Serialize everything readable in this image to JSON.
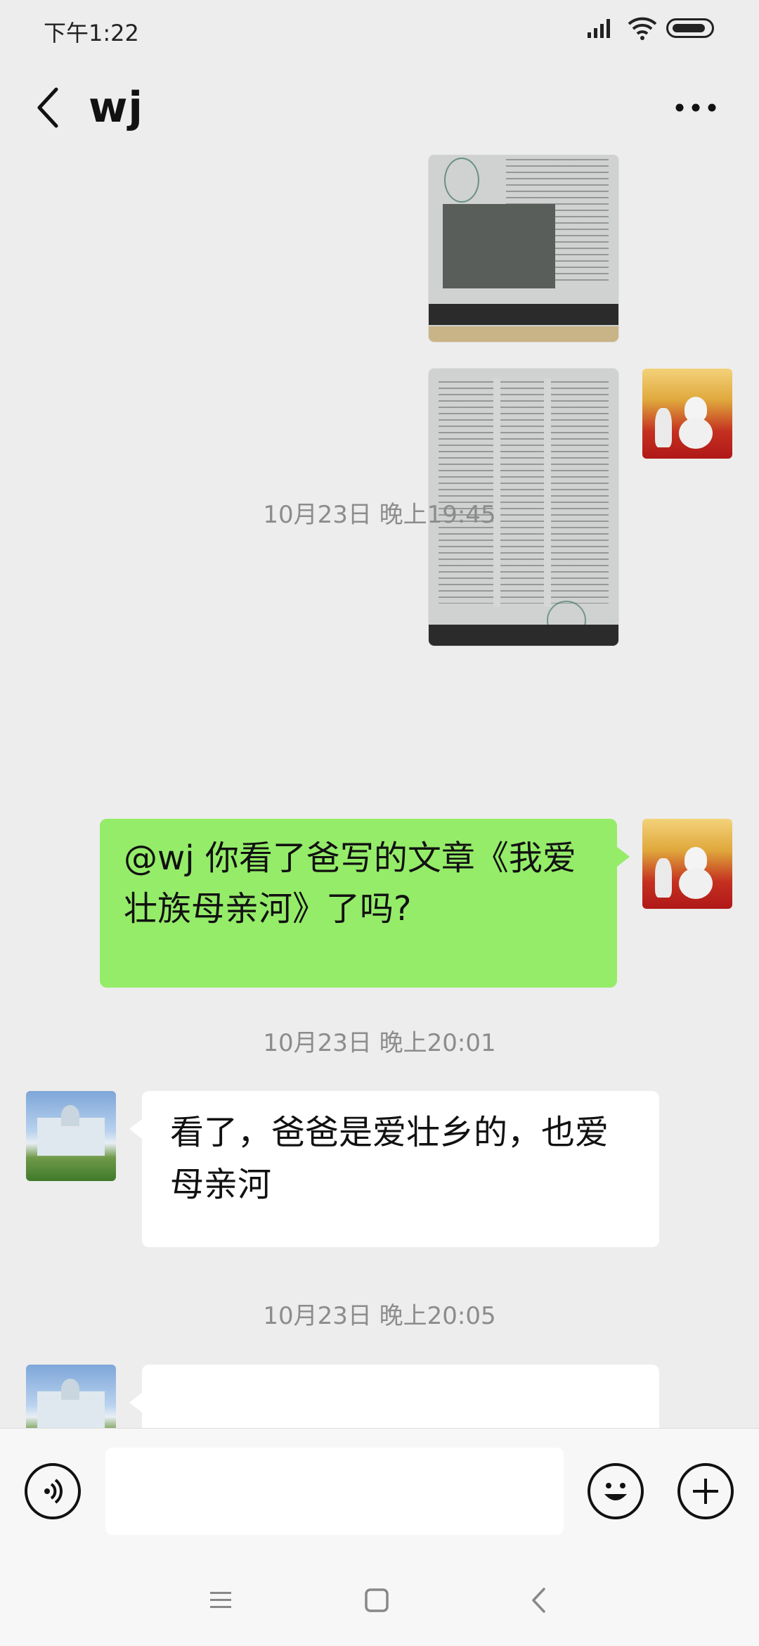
{
  "status_bar": {
    "time": "下午1:22"
  },
  "header": {
    "title": "wj"
  },
  "messages": [
    {
      "type": "image",
      "from": "me",
      "partial": true
    },
    {
      "type": "image",
      "from": "me",
      "watermark": "honor"
    },
    {
      "type": "timestamp",
      "text": "10月23日 晚上19:45"
    },
    {
      "type": "text",
      "from": "me",
      "text": "@wj  你看了爸写的文章《我爱壮族母亲河》了吗?"
    },
    {
      "type": "timestamp",
      "text": "10月23日 晚上20:01"
    },
    {
      "type": "text",
      "from": "wj",
      "text": "看了，爸爸是爱壮乡的，也爱母亲河"
    },
    {
      "type": "timestamp",
      "text": "10月23日 晚上20:05"
    },
    {
      "type": "text",
      "from": "wj",
      "text": "",
      "partial": true
    }
  ],
  "input_bar": {
    "value": "",
    "icons": [
      "voice-icon",
      "emoji-icon",
      "plus-icon"
    ]
  },
  "nav_bar": {
    "icons": [
      "menu-icon",
      "home-icon",
      "back-icon"
    ]
  },
  "colors": {
    "background": "#ededed",
    "sent_bubble": "#95ec69",
    "received_bubble": "#ffffff",
    "timestamp_text": "#8c8c8c"
  }
}
